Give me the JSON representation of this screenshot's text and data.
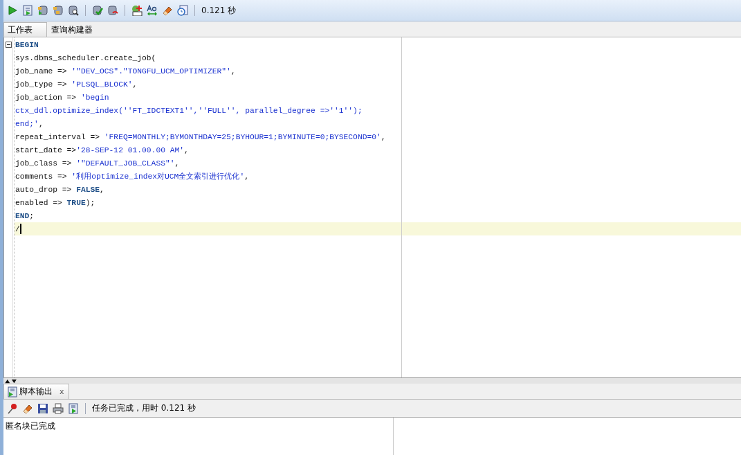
{
  "toolbar": {
    "elapsed": "0.121 秒"
  },
  "tabs": [
    {
      "label": "工作表",
      "selected": true
    },
    {
      "label": "查询构建器",
      "selected": false
    }
  ],
  "editor": {
    "lines": [
      {
        "current": false,
        "segments": [
          {
            "kind": "keyword",
            "text": "BEGIN"
          }
        ]
      },
      {
        "current": false,
        "segments": [
          {
            "kind": "plain",
            "text": "sys.dbms_scheduler.create_job("
          }
        ]
      },
      {
        "current": false,
        "segments": [
          {
            "kind": "plain",
            "text": "job_name => "
          },
          {
            "kind": "string",
            "text": "'\"DEV_OCS\".\"TONGFU_UCM_OPTIMIZER\"'"
          },
          {
            "kind": "plain",
            "text": ","
          }
        ]
      },
      {
        "current": false,
        "segments": [
          {
            "kind": "plain",
            "text": "job_type => "
          },
          {
            "kind": "string",
            "text": "'PLSQL_BLOCK'"
          },
          {
            "kind": "plain",
            "text": ","
          }
        ]
      },
      {
        "current": false,
        "segments": [
          {
            "kind": "plain",
            "text": "job_action => "
          },
          {
            "kind": "string",
            "text": "'begin"
          }
        ]
      },
      {
        "current": false,
        "segments": [
          {
            "kind": "string",
            "text": "ctx_ddl.optimize_index(''FT_IDCTEXT1'',''FULL'', parallel_degree =>''1'');"
          }
        ]
      },
      {
        "current": false,
        "segments": [
          {
            "kind": "string",
            "text": "end;'"
          },
          {
            "kind": "plain",
            "text": ","
          }
        ]
      },
      {
        "current": false,
        "segments": [
          {
            "kind": "plain",
            "text": "repeat_interval => "
          },
          {
            "kind": "string",
            "text": "'FREQ=MONTHLY;BYMONTHDAY=25;BYHOUR=1;BYMINUTE=0;BYSECOND=0'"
          },
          {
            "kind": "plain",
            "text": ","
          }
        ]
      },
      {
        "current": false,
        "segments": [
          {
            "kind": "plain",
            "text": "start_date =>"
          },
          {
            "kind": "string",
            "text": "'28-SEP-12 01.00.00 AM'"
          },
          {
            "kind": "plain",
            "text": ","
          }
        ]
      },
      {
        "current": false,
        "segments": [
          {
            "kind": "plain",
            "text": "job_class => "
          },
          {
            "kind": "string",
            "text": "'\"DEFAULT_JOB_CLASS\"'"
          },
          {
            "kind": "plain",
            "text": ","
          }
        ]
      },
      {
        "current": false,
        "segments": [
          {
            "kind": "plain",
            "text": "comments => "
          },
          {
            "kind": "string",
            "text": "'利用optimize_index对UCM全文索引进行优化'"
          },
          {
            "kind": "plain",
            "text": ","
          }
        ]
      },
      {
        "current": false,
        "segments": [
          {
            "kind": "plain",
            "text": "auto_drop => "
          },
          {
            "kind": "keyword",
            "text": "FALSE"
          },
          {
            "kind": "plain",
            "text": ","
          }
        ]
      },
      {
        "current": false,
        "segments": [
          {
            "kind": "plain",
            "text": "enabled => "
          },
          {
            "kind": "keyword",
            "text": "TRUE"
          },
          {
            "kind": "plain",
            "text": ");"
          }
        ]
      },
      {
        "current": false,
        "segments": [
          {
            "kind": "keyword",
            "text": "END"
          },
          {
            "kind": "plain",
            "text": ";"
          }
        ]
      },
      {
        "current": true,
        "segments": [
          {
            "kind": "plain",
            "text": "/"
          }
        ]
      }
    ]
  },
  "output_panel": {
    "tab": {
      "label": "脚本输出",
      "close": "x"
    },
    "status": "任务已完成，用时 0.121 秒",
    "text": "匿名块已完成"
  }
}
